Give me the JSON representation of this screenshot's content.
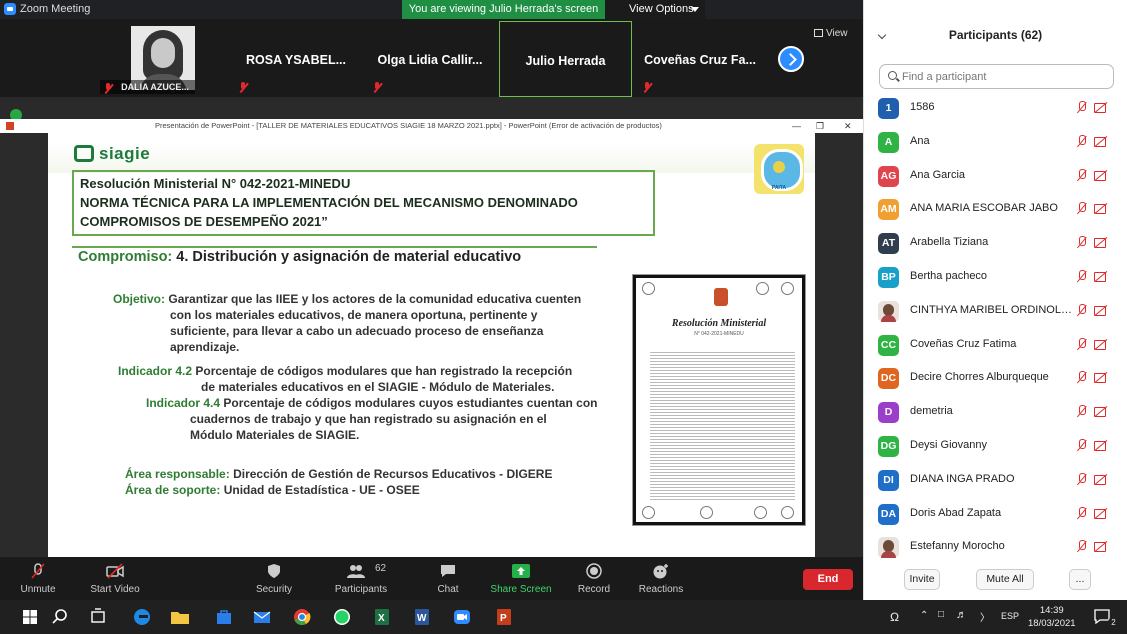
{
  "window": {
    "title": "Zoom Meeting",
    "share_banner": "You are viewing Julio Herrada's screen",
    "view_options": "View Options"
  },
  "video_strip": {
    "tiles": [
      {
        "name": "DALIA AZUCE...",
        "muted": true
      },
      {
        "name": "ROSA   YSABEL...",
        "muted": true
      },
      {
        "name": "Olga  Lidia  Callir...",
        "muted": true
      },
      {
        "name": "Julio Herrada",
        "muted": false,
        "active": true
      },
      {
        "name": "Coveñas  Cruz  Fa...",
        "muted": true
      }
    ],
    "view_label": "View"
  },
  "ppt": {
    "titlebar": "Presentación de PowerPoint - [TALLER DE MATERIALES EDUCATIVOS SIAGIE 18 MARZO 2021.pptx] - PowerPoint (Error de activación de productos)",
    "slide": {
      "brand": "siagie",
      "seal_text": "PAITA",
      "resolution_lines": [
        "Resolución Ministerial N° 042-2021-MINEDU",
        "NORMA TÉCNICA PARA LA IMPLEMENTACIÓN DEL  MECANISMO DENOMINADO",
        "COMPROMISOS DE DESEMPEÑO 2021”"
      ],
      "compromiso_label": "Compromiso:",
      "compromiso_text": "4. Distribución y asignación de material educativo",
      "objetivo_label": "Objetivo:",
      "objetivo_lines": [
        "Garantizar que las IIEE y los actores de la comunidad educativa cuenten",
        "con  los  materiales  educativos,  de  manera  oportuna,  pertinente  y",
        "suficiente,  para  llevar  a  cabo  un  adecuado  proceso  de  enseñanza",
        "aprendizaje."
      ],
      "ind42_label": "Indicador 4.2",
      "ind42_lines": [
        "Porcentaje de códigos modulares que han registrado la recepción",
        "de materiales educativos en el SIAGIE - Módulo de Materiales."
      ],
      "ind44_label": "Indicador 4.4",
      "ind44_lines": [
        "Porcentaje de códigos modulares cuyos estudiantes  cuentan con",
        "cuadernos de trabajo y que han registrado su asignación en el",
        "Módulo Materiales de SIAGIE."
      ],
      "area_resp_label": "Área responsable:",
      "area_resp_text": "Dirección de Gestión de Recursos Educativos - DIGERE",
      "area_sop_label": "Área de soporte:",
      "area_sop_text": "Unidad de Estadística - UE - OSEE",
      "doc_title": "Resolución Ministerial",
      "doc_number": "N° 042-2021-MINEDU"
    }
  },
  "toolbar": {
    "unmute": "Unmute",
    "start_video": "Start Video",
    "security": "Security",
    "participants": "Participants",
    "participants_count": "62",
    "chat": "Chat",
    "share_screen": "Share Screen",
    "record": "Record",
    "reactions": "Reactions",
    "end": "End"
  },
  "participants_panel": {
    "header": "Participants (62)",
    "search_placeholder": "Find a participant",
    "people": [
      {
        "initials": "1",
        "name": "1586",
        "color": "#1f5fae"
      },
      {
        "initials": "A",
        "name": "Ana",
        "color": "#2fb344"
      },
      {
        "initials": "AG",
        "name": "Ana Garcia",
        "color": "#e0454e"
      },
      {
        "initials": "AM",
        "name": "ANA MARIA ESCOBAR JABO",
        "color": "#f0a030"
      },
      {
        "initials": "AT",
        "name": "Arabella Tiziana",
        "color": "#2f3d4f"
      },
      {
        "initials": "BP",
        "name": "Bertha pacheco",
        "color": "#18a0c8"
      },
      {
        "initials": "",
        "name": "CINTHYA MARIBEL ORDINOLA C...",
        "color": "photo"
      },
      {
        "initials": "CC",
        "name": "Coveñas Cruz Fatima",
        "color": "#2fb344"
      },
      {
        "initials": "DC",
        "name": "Decire Chorres Alburqueque",
        "color": "#e0651f"
      },
      {
        "initials": "D",
        "name": "demetria",
        "color": "#9b3fc8"
      },
      {
        "initials": "DG",
        "name": "Deysi Giovanny",
        "color": "#2fb344"
      },
      {
        "initials": "DI",
        "name": "DIANA INGA PRADO",
        "color": "#1f6fc8"
      },
      {
        "initials": "DA",
        "name": "Doris Abad Zapata",
        "color": "#1f6fc8"
      },
      {
        "initials": "",
        "name": "Estefanny Morocho",
        "color": "photo"
      }
    ],
    "invite": "Invite",
    "mute_all": "Mute All",
    "more": "..."
  },
  "taskbar": {
    "lang": "ESP",
    "time": "14:39",
    "date": "18/03/2021",
    "notifications": "2"
  }
}
